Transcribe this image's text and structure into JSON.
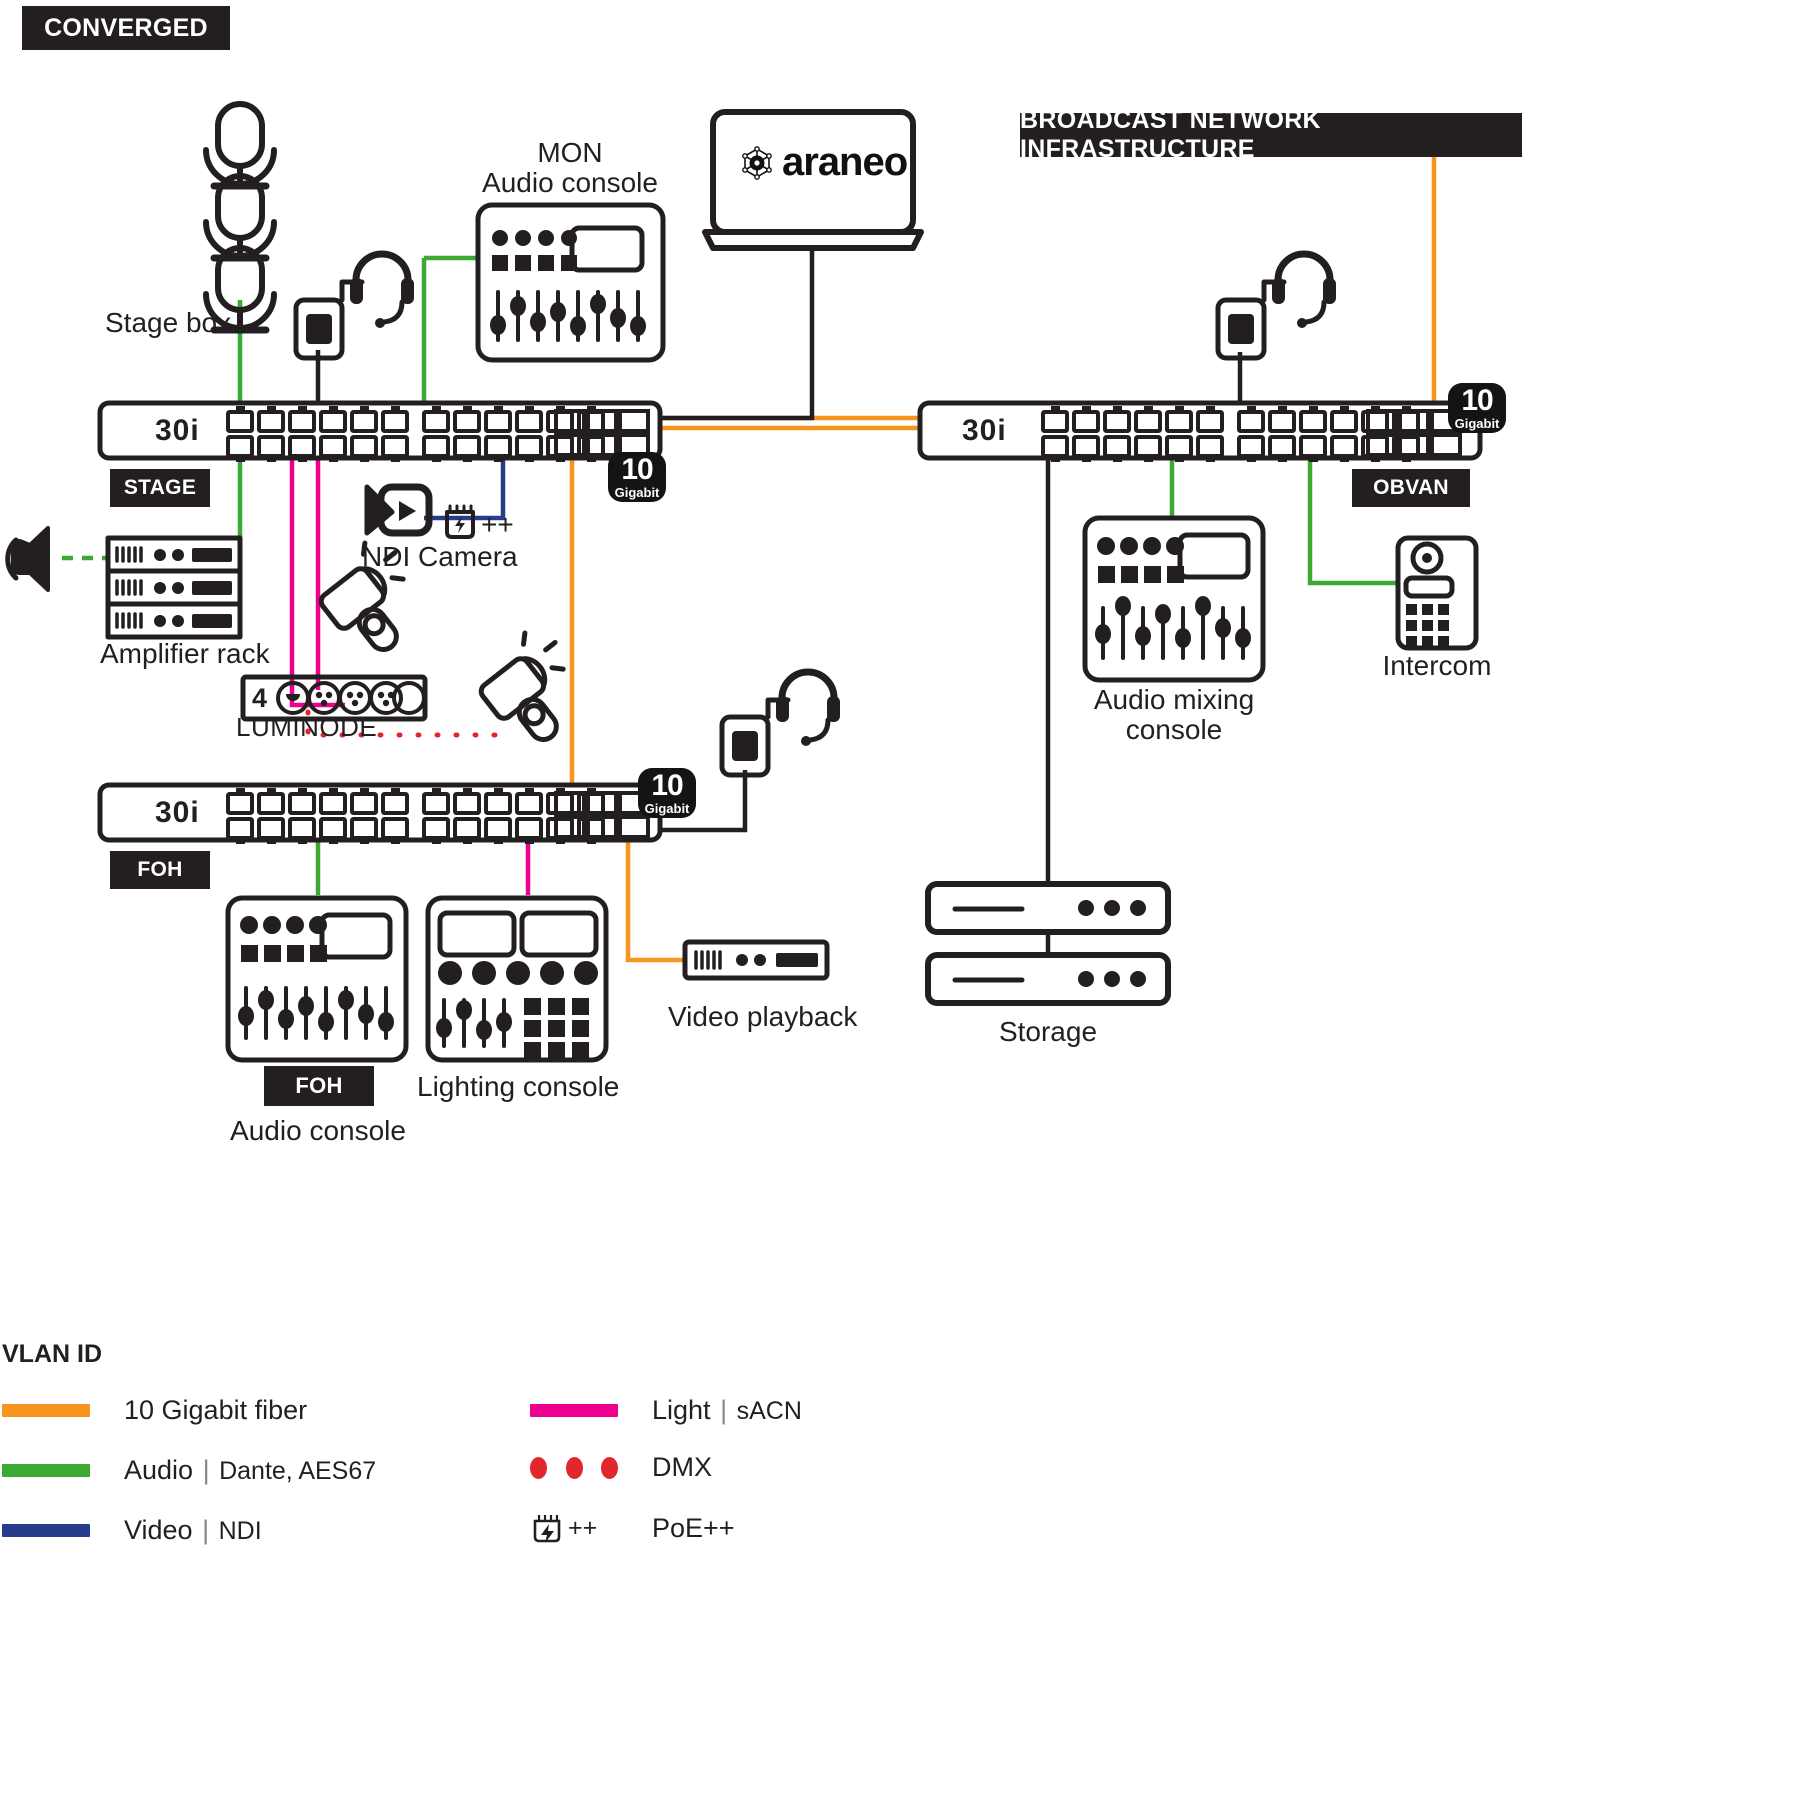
{
  "title_badge": "CONVERGED",
  "right_badge": "BROADCAST NETWORK INFRASTRUCTURE",
  "brand": "araneo",
  "switches": [
    {
      "id": "stage",
      "model": "30i",
      "zone": "STAGE",
      "speed_n": "10",
      "speed_u": "Gigabit"
    },
    {
      "id": "foh",
      "model": "30i",
      "zone": "FOH",
      "speed_n": "10",
      "speed_u": "Gigabit"
    },
    {
      "id": "obvan",
      "model": "30i",
      "zone": "OBVAN",
      "speed_n": "10",
      "speed_u": "Gigabit"
    }
  ],
  "devices": {
    "stage_box": "Stage box",
    "mon_console_l1": "MON",
    "mon_console_l2": "Audio console",
    "amplifier_rack": "Amplifier rack",
    "ndi_camera": "NDI Camera",
    "ndi_poe": "++",
    "luminode_port": "4",
    "luminode": "LUMINODE",
    "foh_badge": "FOH",
    "foh_console": "Audio console",
    "lighting_console": "Lighting console",
    "video_playback": "Video playback",
    "audio_mixing_l1": "Audio mixing",
    "audio_mixing_l2": "console",
    "intercom": "Intercom",
    "storage": "Storage"
  },
  "legend": {
    "title": "VLAN ID",
    "items": [
      {
        "key": "fiber",
        "type": "line",
        "color": "#F7941E",
        "label": "10 Gigabit fiber",
        "sub": ""
      },
      {
        "key": "audio",
        "type": "line",
        "color": "#3AAA35",
        "label": "Audio",
        "sub": "Dante, AES67"
      },
      {
        "key": "video",
        "type": "line",
        "color": "#283C8C",
        "label": "Video",
        "sub": "NDI"
      },
      {
        "key": "light",
        "type": "line",
        "color": "#EC008C",
        "label": "Light",
        "sub": "sACN"
      },
      {
        "key": "dmx",
        "type": "dots",
        "color": "#E1262D",
        "label": "DMX",
        "sub": ""
      },
      {
        "key": "poe",
        "type": "icon",
        "color": "#231f20",
        "label": "PoE++",
        "sub": "",
        "glyph": "++"
      }
    ]
  },
  "colors": {
    "fiber": "#F7941E",
    "audio": "#3AAA35",
    "video": "#283C8C",
    "light": "#EC008C",
    "dmx": "#E1262D",
    "ink": "#231f20"
  }
}
